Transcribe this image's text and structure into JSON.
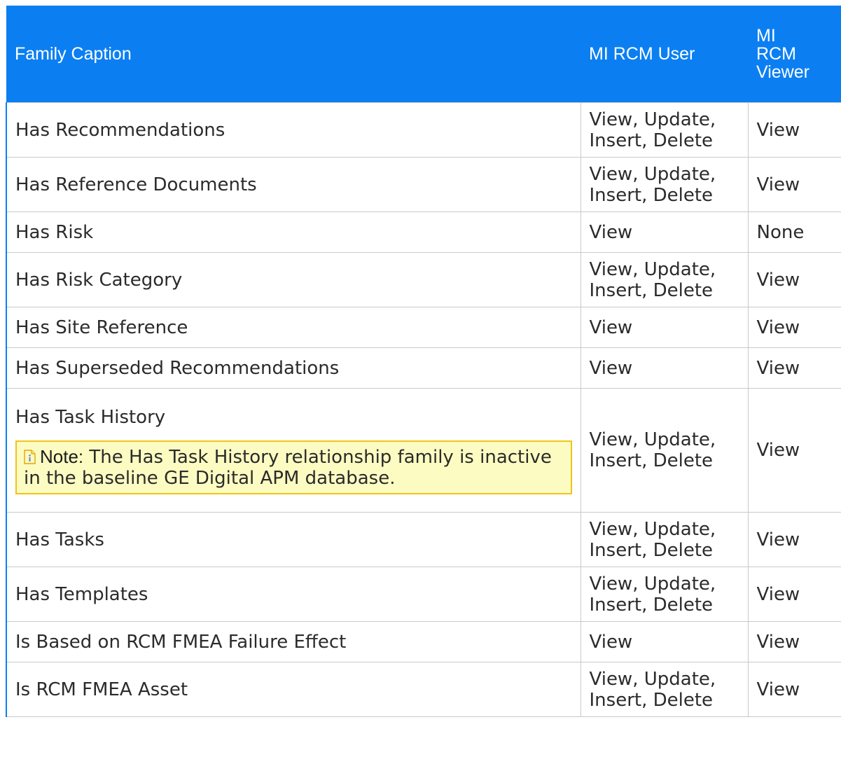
{
  "table": {
    "headers": {
      "family_caption": "Family Caption",
      "rcm_user": "MI RCM User",
      "rcm_viewer": "MI RCM Viewer"
    },
    "rows": [
      {
        "caption": "Has Recommendations",
        "user": "View, Update, Insert, Delete",
        "viewer": "View"
      },
      {
        "caption": "Has Reference Documents",
        "user": "View, Update, Insert, Delete",
        "viewer": "View"
      },
      {
        "caption": "Has Risk",
        "user": "View",
        "viewer": "None"
      },
      {
        "caption": "Has Risk Category",
        "user": "View, Update, Insert, Delete",
        "viewer": "View"
      },
      {
        "caption": "Has Site Reference",
        "user": "View",
        "viewer": "View"
      },
      {
        "caption": "Has Superseded Recommendations",
        "user": "View",
        "viewer": "View"
      },
      {
        "caption": "Has Task History",
        "user": "View, Update, Insert, Delete",
        "viewer": "View",
        "note_label": "Note:",
        "note_text": "The Has Task History relationship family is inactive in the baseline GE Digital APM database."
      },
      {
        "caption": "Has Tasks",
        "user": "View, Update, Insert, Delete",
        "viewer": "View"
      },
      {
        "caption": "Has Templates",
        "user": "View, Update, Insert, Delete",
        "viewer": "View"
      },
      {
        "caption": "Is Based on RCM FMEA Failure Effect",
        "user": "View",
        "viewer": "View"
      },
      {
        "caption": "Is RCM FMEA Asset",
        "user": "View, Update, Insert, Delete",
        "viewer": "View"
      }
    ]
  },
  "icons": {
    "note": "note-info-icon"
  },
  "colors": {
    "header_bg": "#0b7ff2",
    "note_bg": "#fcfcc2",
    "note_border": "#f0c419"
  }
}
